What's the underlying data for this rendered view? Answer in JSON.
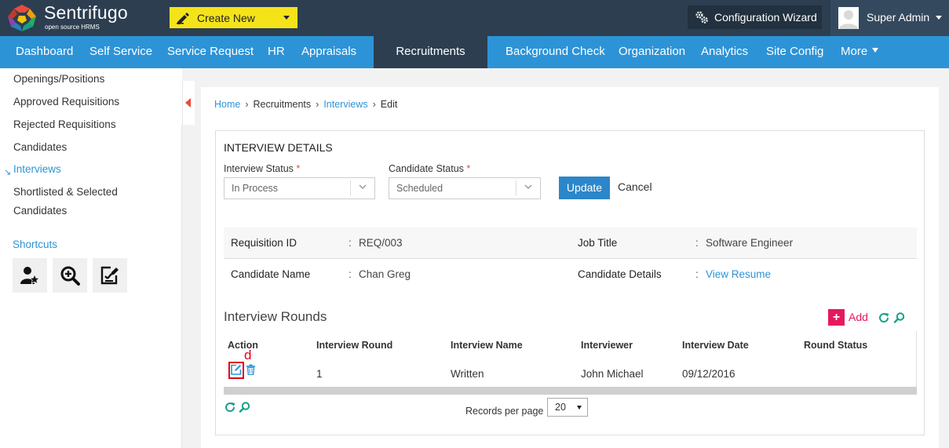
{
  "app": {
    "brand": "Sentrifugo",
    "tagline": "open source HRMS",
    "create_new": "Create New",
    "config_wizard": "Configuration Wizard",
    "user_name": "Super Admin"
  },
  "nav": {
    "items": [
      {
        "label": "Dashboard"
      },
      {
        "label": "Self Service"
      },
      {
        "label": "Service Request"
      },
      {
        "label": "HR"
      },
      {
        "label": "Appraisals"
      },
      {
        "label": "Recruitments"
      },
      {
        "label": "Background Check"
      },
      {
        "label": "Organization"
      },
      {
        "label": "Analytics"
      },
      {
        "label": "Site Config"
      },
      {
        "label": "More"
      }
    ]
  },
  "sidebar": {
    "items": [
      {
        "label": "Openings/Positions"
      },
      {
        "label": "Approved Requisitions"
      },
      {
        "label": "Rejected Requisitions"
      },
      {
        "label": "Candidates"
      },
      {
        "label": "Interviews"
      },
      {
        "label": "Shortlisted & Selected"
      },
      {
        "label": "Candidates"
      }
    ],
    "shortcuts_label": "Shortcuts"
  },
  "breadcrumb": [
    "Home",
    "Recruitments",
    "Interviews",
    "Edit"
  ],
  "interview": {
    "title": "INTERVIEW DETAILS",
    "status_label": "Interview Status",
    "status_value": "In Process",
    "candidate_status_label": "Candidate Status",
    "candidate_status_value": "Scheduled",
    "required_mark": "*",
    "update": "Update",
    "cancel": "Cancel"
  },
  "info": {
    "colon": ":",
    "requisition_id_label": "Requisition ID",
    "requisition_id_value": "REQ/003",
    "job_title_label": "Job Title",
    "job_title_value": "Software Engineer",
    "candidate_name_label": "Candidate Name",
    "candidate_name_value": "Chan Greg",
    "candidate_details_label": "Candidate Details",
    "candidate_details_value": "View Resume"
  },
  "rounds": {
    "title": "Interview Rounds",
    "add": "Add",
    "plus": "+",
    "columns": [
      "Action",
      "Interview Round",
      "Interview Name",
      "Interviewer",
      "Interview Date",
      "Round Status"
    ],
    "rows": [
      {
        "round": "1",
        "name": "Written",
        "interviewer": "John Michael",
        "date": "09/12/2016",
        "status": ""
      }
    ],
    "annotation": "d",
    "records_per_page_label": "Records per page",
    "records_per_page_value": "20"
  },
  "colors": {
    "topbar": "#2c3e50",
    "nav": "#2d93d7",
    "create_new": "#f5e31a",
    "accent_pink": "#e5195f",
    "link": "#2d93d7",
    "update_button": "#2c86c9",
    "highlight": "#e1001a"
  },
  "icons": {
    "logo": "sentrifugo-logo",
    "create_new": "pen-icon",
    "config": "gears-icon",
    "avatar": "user-avatar",
    "shortcuts": [
      "user-star-icon",
      "zoom-search-icon",
      "edit-check-icon"
    ],
    "refresh": "refresh-icon",
    "search": "search-icon",
    "edit": "edit-icon",
    "delete": "trash-icon"
  }
}
